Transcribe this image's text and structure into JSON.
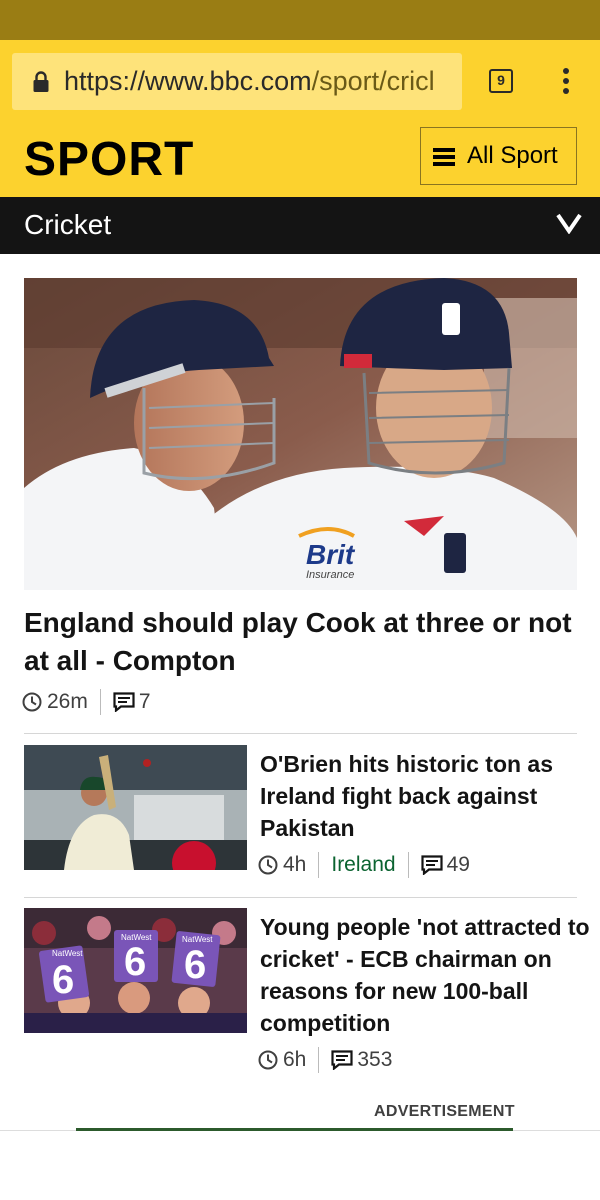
{
  "browser": {
    "url_host": "https://www.bbc.com",
    "url_path": "/sport/cricl",
    "tab_count": "9"
  },
  "header": {
    "logo": "SPORT",
    "all_sport_label": "All Sport"
  },
  "section": {
    "title": "Cricket"
  },
  "hero": {
    "headline": "England should play Cook at three or not at all - Compton",
    "time": "26m",
    "comments": "7",
    "image": {
      "sponsor_word": "Brit",
      "sponsor_sub": "Insurance"
    }
  },
  "stories": [
    {
      "headline": "O'Brien hits historic ton as Ireland fight back against Pakistan",
      "time": "4h",
      "topic": "Ireland",
      "comments": "49"
    },
    {
      "headline": "Young people 'not attracted to cricket' - ECB chairman on reasons for new 100-ball competition",
      "time": "6h",
      "comments": "353",
      "image": {
        "card_number": "6",
        "card_brand": "NatWest"
      }
    }
  ],
  "advertisement": {
    "label": "ADVERTISEMENT"
  },
  "colors": {
    "status_bar": "#9a7d14",
    "brand_yellow": "#fcd22e",
    "section_bar": "#141414",
    "topic_link": "#0b6330",
    "card_purple": "#7a55b8"
  }
}
